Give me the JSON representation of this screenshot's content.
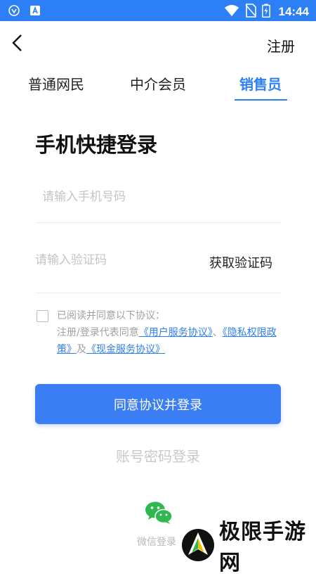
{
  "status_bar": {
    "time": "14:44",
    "icons": [
      "shield-icon",
      "a-icon",
      "wifi-icon",
      "no-sim-icon",
      "battery-charging-icon"
    ]
  },
  "nav": {
    "back_icon": "chevron-left-icon",
    "register_label": "注册"
  },
  "tabs": [
    {
      "label": "普通网民",
      "active": false
    },
    {
      "label": "中介会员",
      "active": false
    },
    {
      "label": "销售员",
      "active": true
    }
  ],
  "title": "手机快捷登录",
  "phone_field": {
    "placeholder": "请输入手机号码",
    "value": ""
  },
  "code_field": {
    "placeholder": "请输入验证码",
    "value": "",
    "get_code_label": "获取验证码"
  },
  "agreement": {
    "checked": false,
    "line1": "已阅读并同意以下协议：",
    "prefix": "注册/登录代表同意",
    "link1": "《用户服务协议》",
    "sep": "、",
    "link2": "《隐私权限政策》",
    "and": "及",
    "link3": "《现金服务协议》"
  },
  "login_button": "同意协议并登录",
  "password_login": "账号密码登录",
  "wechat": {
    "label": "微信登录",
    "icon": "wechat-icon"
  },
  "watermark": {
    "text": "极限手游网"
  },
  "colors": {
    "accent": "#2d7ff5",
    "button": "#3b7df3",
    "placeholder": "#c4c4c4"
  }
}
